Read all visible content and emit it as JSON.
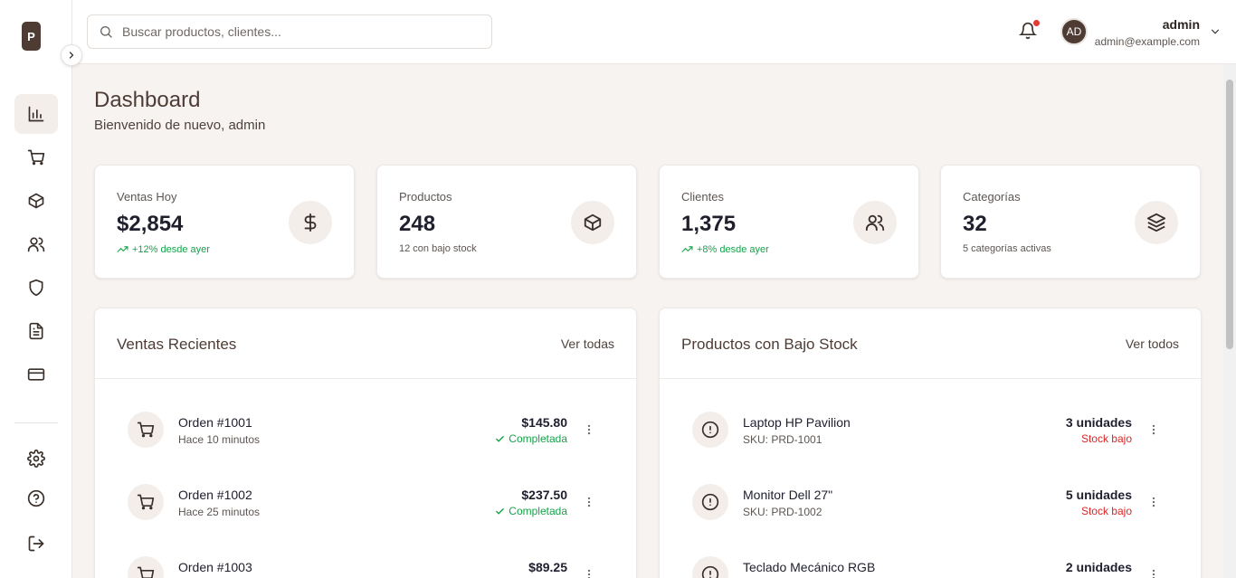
{
  "brand": {
    "logo_letter": "P"
  },
  "search": {
    "placeholder": "Buscar productos, clientes..."
  },
  "user": {
    "initials": "AD",
    "name": "admin",
    "email": "admin@example.com"
  },
  "sidebar": {
    "items": [
      {
        "icon": "chart-icon",
        "active": true
      },
      {
        "icon": "cart-icon"
      },
      {
        "icon": "box-icon"
      },
      {
        "icon": "users-icon"
      },
      {
        "icon": "shield-icon"
      },
      {
        "icon": "document-icon"
      },
      {
        "icon": "credit-card-icon"
      }
    ],
    "bottom_items": [
      {
        "icon": "gear-icon"
      },
      {
        "icon": "help-icon"
      },
      {
        "icon": "logout-icon"
      }
    ]
  },
  "page": {
    "title": "Dashboard",
    "subtitle": "Bienvenido de nuevo, admin"
  },
  "stats": [
    {
      "label": "Ventas Hoy",
      "value": "$2,854",
      "sub": "+12% desde ayer",
      "icon": "dollar-icon"
    },
    {
      "label": "Productos",
      "value": "248",
      "sub": "12 con bajo stock",
      "icon": "box-icon"
    },
    {
      "label": "Clientes",
      "value": "1,375",
      "sub": "+8% desde ayer",
      "icon": "users-icon"
    },
    {
      "label": "Categorías",
      "value": "32",
      "sub": "5 categorías activas",
      "icon": "layers-icon"
    }
  ],
  "recent_sales": {
    "title": "Ventas Recientes",
    "link": "Ver todas",
    "rows": [
      {
        "title": "Orden #1001",
        "sub": "Hace 10 minutos",
        "value": "$145.80",
        "status": "Completada"
      },
      {
        "title": "Orden #1002",
        "sub": "Hace 25 minutos",
        "value": "$237.50",
        "status": "Completada"
      },
      {
        "title": "Orden #1003",
        "sub": "",
        "value": "$89.25",
        "status": ""
      }
    ]
  },
  "low_stock": {
    "title": "Productos con Bajo Stock",
    "link": "Ver todos",
    "rows": [
      {
        "title": "Laptop HP Pavilion",
        "sub": "SKU: PRD-1001",
        "value": "3 unidades",
        "status": "Stock bajo"
      },
      {
        "title": "Monitor Dell 27\"",
        "sub": "SKU: PRD-1002",
        "value": "5 unidades",
        "status": "Stock bajo"
      },
      {
        "title": "Teclado Mecánico RGB",
        "sub": "",
        "value": "2 unidades",
        "status": ""
      }
    ]
  },
  "colors": {
    "brand": "#4e3c34",
    "success": "#16a34a",
    "danger": "#dc2626",
    "background": "#f6f3f1"
  }
}
